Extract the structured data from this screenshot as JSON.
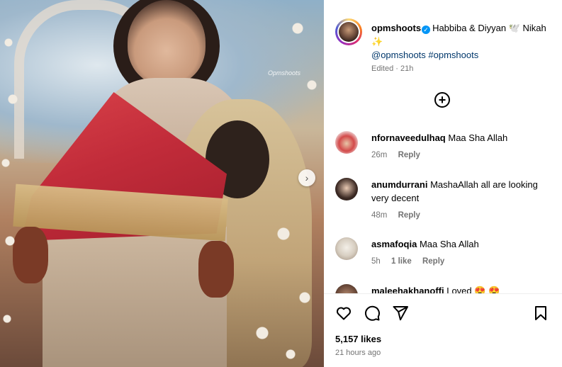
{
  "post": {
    "username": "opmshoots",
    "caption": "Habbiba & Diyyan 🕊️ Nikah ✨",
    "tags": "@opmshoots #opmshoots",
    "edited": "Edited · 21h",
    "watermark": "Opmshoots"
  },
  "comments": [
    {
      "username": "nfornaveedulhaq",
      "text": "Maa Sha Allah",
      "time": "26m",
      "likes": "",
      "reply": "Reply"
    },
    {
      "username": "anumdurrani",
      "text": "MashaAllah all are looking very decent",
      "time": "48m",
      "likes": "",
      "reply": "Reply"
    },
    {
      "username": "asmafoqia",
      "text": "Maa Sha Allah",
      "time": "5h",
      "likes": "1 like",
      "reply": "Reply"
    },
    {
      "username": "maleehakhanoffi",
      "text": "Loved 😍 😍",
      "time": "",
      "likes": "",
      "reply": ""
    }
  ],
  "footer": {
    "likes": "5,157 likes",
    "time_ago": "21 hours ago"
  },
  "icons": {
    "like": "heart-icon",
    "comment": "comment-icon",
    "share": "send-icon",
    "save": "bookmark-icon",
    "more": "plus-circle-icon",
    "next": "chevron-right-icon"
  },
  "colors": {
    "verified": "#0095f6",
    "link": "#00376b",
    "muted": "#737373"
  }
}
